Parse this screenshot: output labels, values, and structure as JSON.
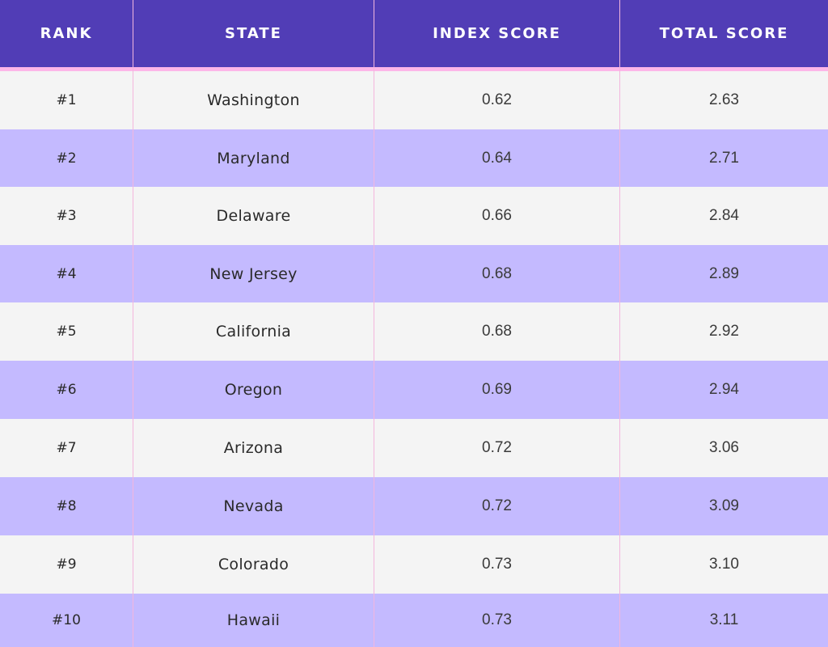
{
  "chart_data": {
    "type": "table",
    "columns": [
      "RANK",
      "STATE",
      "INDEX SCORE",
      "TOTAL SCORE"
    ],
    "rows": [
      [
        "#1",
        "Washington",
        "0.62",
        "2.63"
      ],
      [
        "#2",
        "Maryland",
        "0.64",
        "2.71"
      ],
      [
        "#3",
        "Delaware",
        "0.66",
        "2.84"
      ],
      [
        "#4",
        "New Jersey",
        "0.68",
        "2.89"
      ],
      [
        "#5",
        "California",
        "0.68",
        "2.92"
      ],
      [
        "#6",
        "Oregon",
        "0.69",
        "2.94"
      ],
      [
        "#7",
        "Arizona",
        "0.72",
        "3.06"
      ],
      [
        "#8",
        "Nevada",
        "0.72",
        "3.09"
      ],
      [
        "#9",
        "Colorado",
        "0.73",
        "3.10"
      ],
      [
        "#10",
        "Hawaii",
        "0.73",
        "3.11"
      ]
    ]
  },
  "colors": {
    "header_bg": "#513db6",
    "header_text": "#ffffff",
    "header_accent": "#fdb6e8",
    "row_light": "#f4f4f4",
    "row_lavender": "#c4baff",
    "divider": "#f3b6dd",
    "text": "#2a2a2a"
  }
}
